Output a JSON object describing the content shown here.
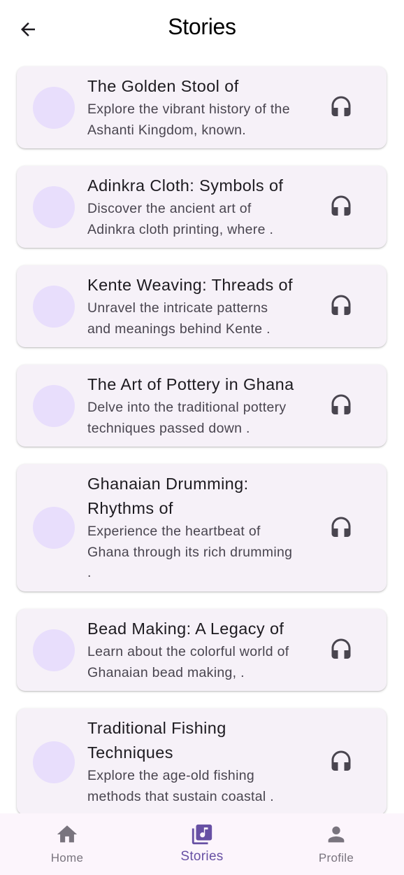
{
  "app_bar": {
    "title": "Stories",
    "back_icon": "arrow-back-icon"
  },
  "stories": [
    {
      "title_lines": [
        "The Golden Stool of"
      ],
      "description_lines": [
        "Explore the vibrant history of the",
        "Ashanti Kingdom, known."
      ],
      "action_icon": "headphones-icon"
    },
    {
      "title_lines": [
        "Adinkra Cloth: Symbols of"
      ],
      "description_lines": [
        "Discover the ancient art of",
        "Adinkra cloth printing, where ."
      ],
      "action_icon": "headphones-icon"
    },
    {
      "title_lines": [
        "Kente Weaving: Threads of"
      ],
      "description_lines": [
        "Unravel the intricate patterns",
        "and meanings behind Kente ."
      ],
      "action_icon": "headphones-icon"
    },
    {
      "title_lines": [
        "The Art of Pottery in Ghana"
      ],
      "description_lines": [
        "Delve into the traditional pottery",
        "techniques passed down ."
      ],
      "action_icon": "headphones-icon"
    },
    {
      "title_lines": [
        "Ghanaian Drumming:",
        "Rhythms of"
      ],
      "description_lines": [
        "Experience the heartbeat of",
        "Ghana through its rich drumming",
        "."
      ],
      "action_icon": "headphones-icon"
    },
    {
      "title_lines": [
        "Bead Making: A Legacy of"
      ],
      "description_lines": [
        "Learn about the colorful world of",
        "Ghanaian bead making, ."
      ],
      "action_icon": "headphones-icon"
    },
    {
      "title_lines": [
        "Traditional Fishing",
        "Techniques"
      ],
      "description_lines": [
        "Explore the age-old fishing",
        "methods that sustain coastal ."
      ],
      "action_icon": "headphones-icon"
    }
  ],
  "bottom_nav": {
    "items": [
      {
        "label": "Home",
        "icon": "home-icon",
        "active": false
      },
      {
        "label": "Stories",
        "icon": "library-music-icon",
        "active": true
      },
      {
        "label": "Profile",
        "icon": "person-icon",
        "active": false
      }
    ]
  },
  "colors": {
    "background": "#ffffff",
    "card": "#f6f1f8",
    "avatar": "#e8defc",
    "title_text": "#1d1b20",
    "body_text": "#49454f",
    "icon": "#49454f",
    "nav_background": "#fcf5fc",
    "nav_active": "#6750a4",
    "nav_inactive": "#79747e"
  }
}
